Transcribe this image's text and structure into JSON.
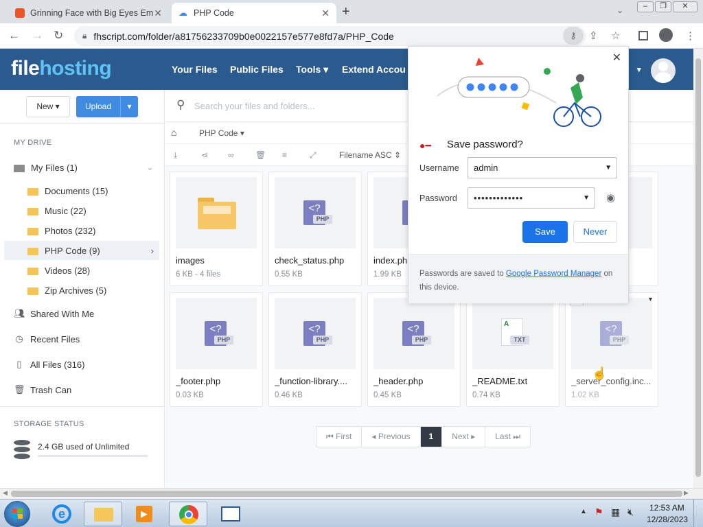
{
  "browser": {
    "tabs": [
      {
        "title": "Grinning Face with Big Eyes Em",
        "active": false
      },
      {
        "title": "PHP Code",
        "active": true
      }
    ],
    "url": "fhscript.com/folder/a81756233709b0e0022157e577e8fd7a/PHP_Code"
  },
  "site": {
    "logo_a": "file",
    "logo_b": "hosting",
    "nav": [
      "Your Files",
      "Public Files",
      "Tools",
      "Extend Accou"
    ]
  },
  "sidebar": {
    "new_label": "New",
    "upload_label": "Upload",
    "my_drive": "MY DRIVE",
    "my_files": "My Files (1)",
    "folders": [
      "Documents (15)",
      "Music (22)",
      "Photos (232)",
      "PHP Code (9)",
      "Videos (28)",
      "Zip Archives (5)"
    ],
    "links": [
      "Shared With Me",
      "Recent Files",
      "All Files (316)",
      "Trash Can"
    ],
    "storage_header": "STORAGE STATUS",
    "storage_text": "2.4 GB used of Unlimited"
  },
  "main": {
    "search_placeholder": "Search your files and folders...",
    "breadcrumb": "PHP Code",
    "sort": "Filename ASC",
    "files": [
      {
        "name": "images",
        "size": "6 KB - 4 files",
        "type": "folder"
      },
      {
        "name": "check_status.php",
        "size": "0.55 KB",
        "type": "php"
      },
      {
        "name": "index.php",
        "size": "1.99 KB",
        "type": "php"
      },
      {
        "name": "_footer.php",
        "size": "0.03 KB",
        "type": "php"
      },
      {
        "name": "_function-library....",
        "size": "0.46 KB",
        "type": "php"
      },
      {
        "name": "_header.php",
        "size": "0.45 KB",
        "type": "php"
      },
      {
        "name": "_README.txt",
        "size": "0.74 KB",
        "type": "txt"
      },
      {
        "name": "_server_config.inc...",
        "size": "1.02 KB",
        "type": "php"
      }
    ],
    "pager": {
      "first": "First",
      "previous": "Previous",
      "page": "1",
      "next": "Next",
      "last": "Last"
    }
  },
  "popup": {
    "title": "Save password?",
    "username_label": "Username",
    "username_value": "admin",
    "password_label": "Password",
    "password_value": "•••••••••••••",
    "save": "Save",
    "never": "Never",
    "footer_pre": "Passwords are saved to ",
    "footer_link": "Google Password Manager",
    "footer_post": " on this device."
  },
  "taskbar": {
    "time": "12:53 AM",
    "date": "12/28/2023"
  },
  "colors": {
    "header": "#2a5a8e",
    "accent": "#1a73e8",
    "upload": "#3f8be1"
  }
}
